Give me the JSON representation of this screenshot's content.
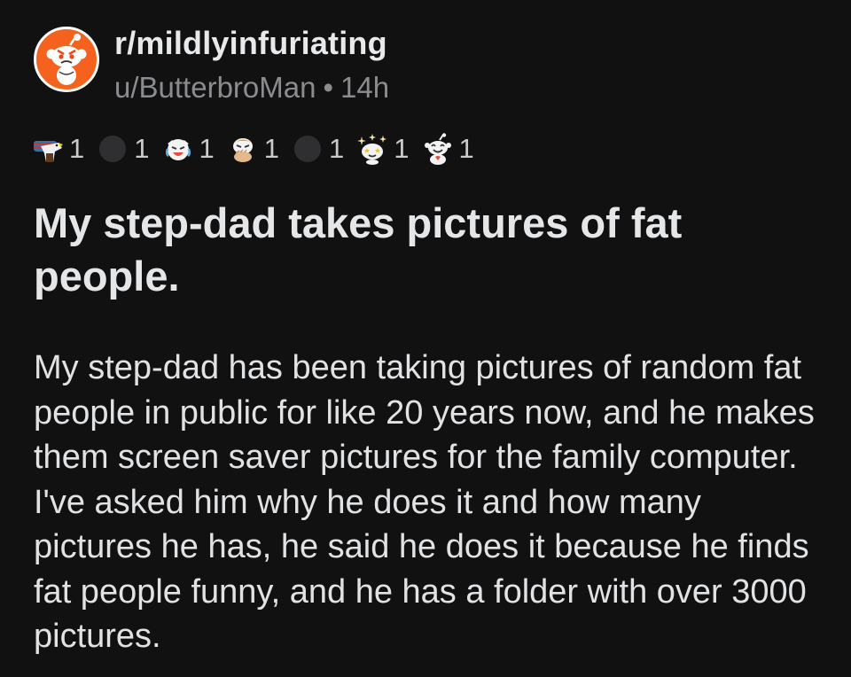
{
  "post": {
    "subreddit": "r/mildlyinfuriating",
    "author": "u/ButterbroMan",
    "separator": "•",
    "age": "14h",
    "title": "My step-dad takes pictures of fat people.",
    "body": "My step-dad has been taking pictures of random fat people in public for like 20 years now, and he makes them screen saver pictures for the family computer. I've asked him why he does it and how many pictures he has, he said he does it because he finds fat people funny, and he has a folder with over 3000 pictures."
  },
  "awards": [
    {
      "icon": "eagle-award-icon",
      "count": "1"
    },
    {
      "icon": "dark-circle-award-icon",
      "count": "1"
    },
    {
      "icon": "crying-laughing-award-icon",
      "count": "1"
    },
    {
      "icon": "facepalm-award-icon",
      "count": "1"
    },
    {
      "icon": "dark-circle-award-icon",
      "count": "1"
    },
    {
      "icon": "starstruck-award-icon",
      "count": "1"
    },
    {
      "icon": "wholesome-award-icon",
      "count": "1"
    }
  ],
  "colors": {
    "background": "#111112",
    "avatar_bg": "#f4621e",
    "text_primary": "#e4e6e8",
    "text_muted": "#8a8c8f"
  }
}
